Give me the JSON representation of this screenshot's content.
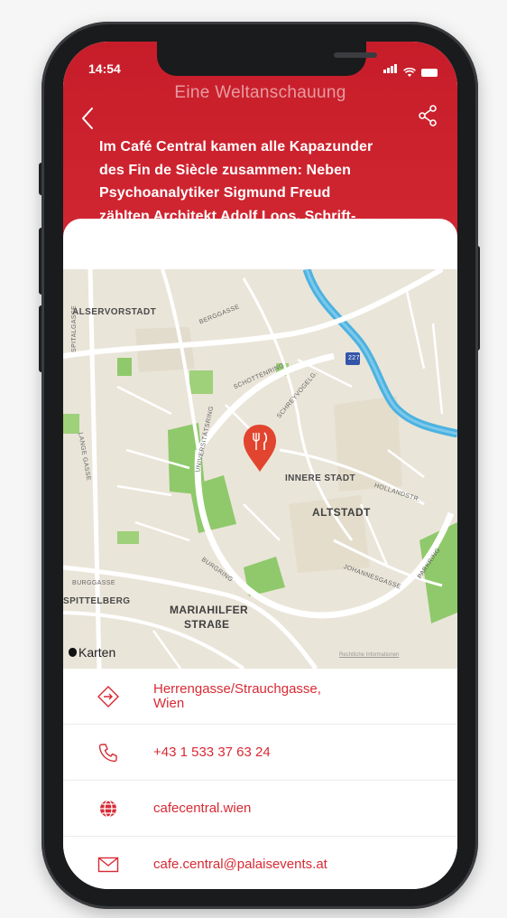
{
  "status": {
    "time": "14:54"
  },
  "header": {
    "title": "Eine Weltanschauung",
    "intro_lines": [
      "Im Café Central kamen alle Kapazunder",
      "des Fin de Siècle zusammen: Neben",
      "Psychoanalytiker Sigmund Freud",
      "zählten Architekt Adolf Loos, Schrift-"
    ]
  },
  "map": {
    "labels": {
      "alservorstadt": "ALSERVORSTADT",
      "spitalgasse": "SPITALGASSE",
      "berggasse": "BERGGASSE",
      "schottenring": "SCHOTTENRING",
      "highway": "227",
      "schreyvogelgasse": "SCHREYVOGELG.",
      "universitaetsring": "UNIVERSITÄTSRING",
      "langegasse": "LANGE GASSE",
      "innere_stadt": "INNERE STADT",
      "altstadt": "ALTSTADT",
      "hollandstr": "HOLLANDSTR.",
      "parkring": "PARKRING",
      "johannesgasse": "JOHANNESGASSE",
      "burggasse": "BURGGASSE",
      "spittelberg": "SPITTELBERG",
      "mariahilfer_1": "MARIAHILFER",
      "mariahilfer_2": "STRAßE",
      "burgring": "BURGRING",
      "karten": "Karten",
      "legal": "Rechtliche Informationen"
    },
    "pin_icon": "restaurant-pin-icon",
    "colors": {
      "land": "#eae5d9",
      "roads": "#ffffff",
      "water": "#4cb2e0",
      "parks": "#8fc96b",
      "pin": "#e2452f"
    }
  },
  "contact": [
    {
      "icon": "directions-icon",
      "label": "Herrengasse/Strauchgasse,\n Wien"
    },
    {
      "icon": "phone-icon",
      "label": "+43 1 533 37 63 24"
    },
    {
      "icon": "globe-icon",
      "label": "cafecentral.wien"
    },
    {
      "icon": "mail-icon",
      "label": "cafe.central@palaisevents.at"
    }
  ],
  "accent": "#d82a34",
  "header_color": "#c71d2a"
}
